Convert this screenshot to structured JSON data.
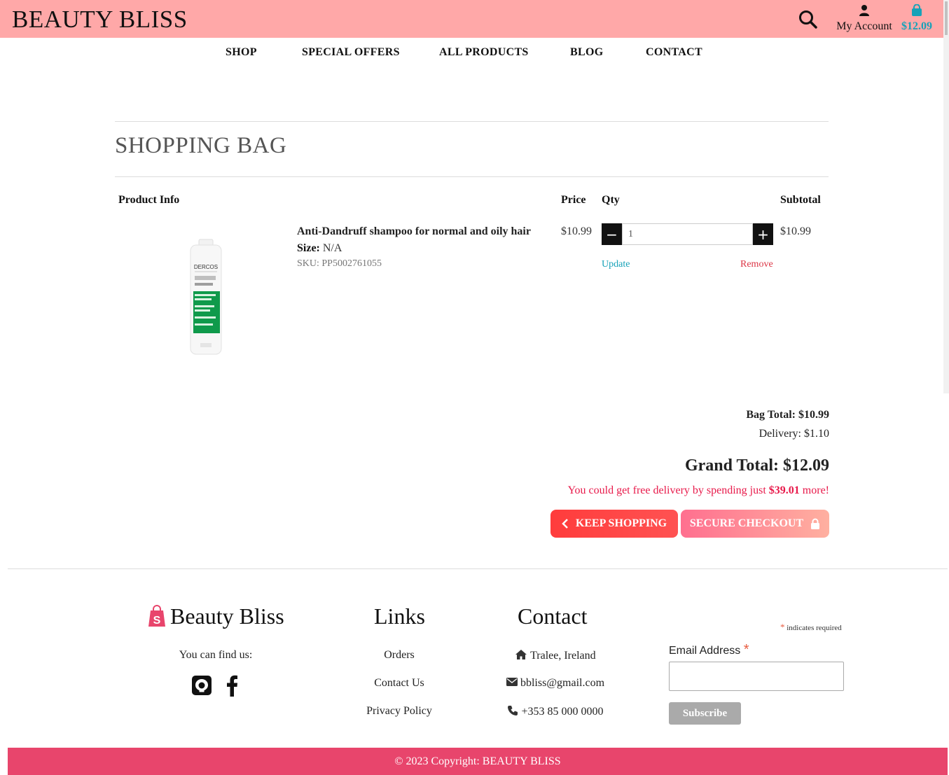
{
  "header": {
    "brand": "BEAUTY BLISS",
    "account_label": "My Account",
    "bag_total": "$12.09"
  },
  "nav": {
    "items": [
      "SHOP",
      "SPECIAL OFFERS",
      "ALL PRODUCTS",
      "BLOG",
      "CONTACT"
    ]
  },
  "bag": {
    "title": "SHOPPING BAG",
    "columns": {
      "product_info": "Product Info",
      "price": "Price",
      "qty": "Qty",
      "subtotal": "Subtotal"
    },
    "items": [
      {
        "name": "Anti-Dandruff shampoo for normal and oily hair",
        "size_label": "Size:",
        "size_value": "N/A",
        "sku": "SKU: PP5002761055",
        "price": "$10.99",
        "qty": "1",
        "subtotal": "$10.99",
        "update_label": "Update",
        "remove_label": "Remove",
        "image_text": "DERCOS"
      }
    ],
    "totals": {
      "bag_total": "Bag Total: $10.99",
      "delivery": "Delivery: $1.10",
      "grand_total": "Grand Total: $12.09",
      "free_delivery_prefix": "You could get free delivery by spending just ",
      "free_delivery_amount": "$39.01",
      "free_delivery_suffix": " more!"
    },
    "buttons": {
      "keep_shopping": "KEEP SHOPPING",
      "secure_checkout": "SECURE CHECKOUT"
    }
  },
  "footer": {
    "brand": "Beauty Bliss",
    "find_us": "You can find us:",
    "links_title": "Links",
    "links": [
      "Orders",
      "Contact Us",
      "Privacy Policy"
    ],
    "contact_title": "Contact",
    "contact": {
      "address": "Tralee, Ireland",
      "email": "bbliss@gmail.com",
      "phone": "+353 85 000 0000"
    },
    "newsletter": {
      "required_note": "indicates required",
      "email_label": "Email Address",
      "subscribe": "Subscribe"
    },
    "copyright": "© 2023 Copyright: BEAUTY BLISS"
  },
  "colors": {
    "header_bg": "#ffa8a8",
    "accent_teal": "#17a2b8",
    "accent_red": "#dc3545",
    "footer_bar": "#e8456c"
  }
}
